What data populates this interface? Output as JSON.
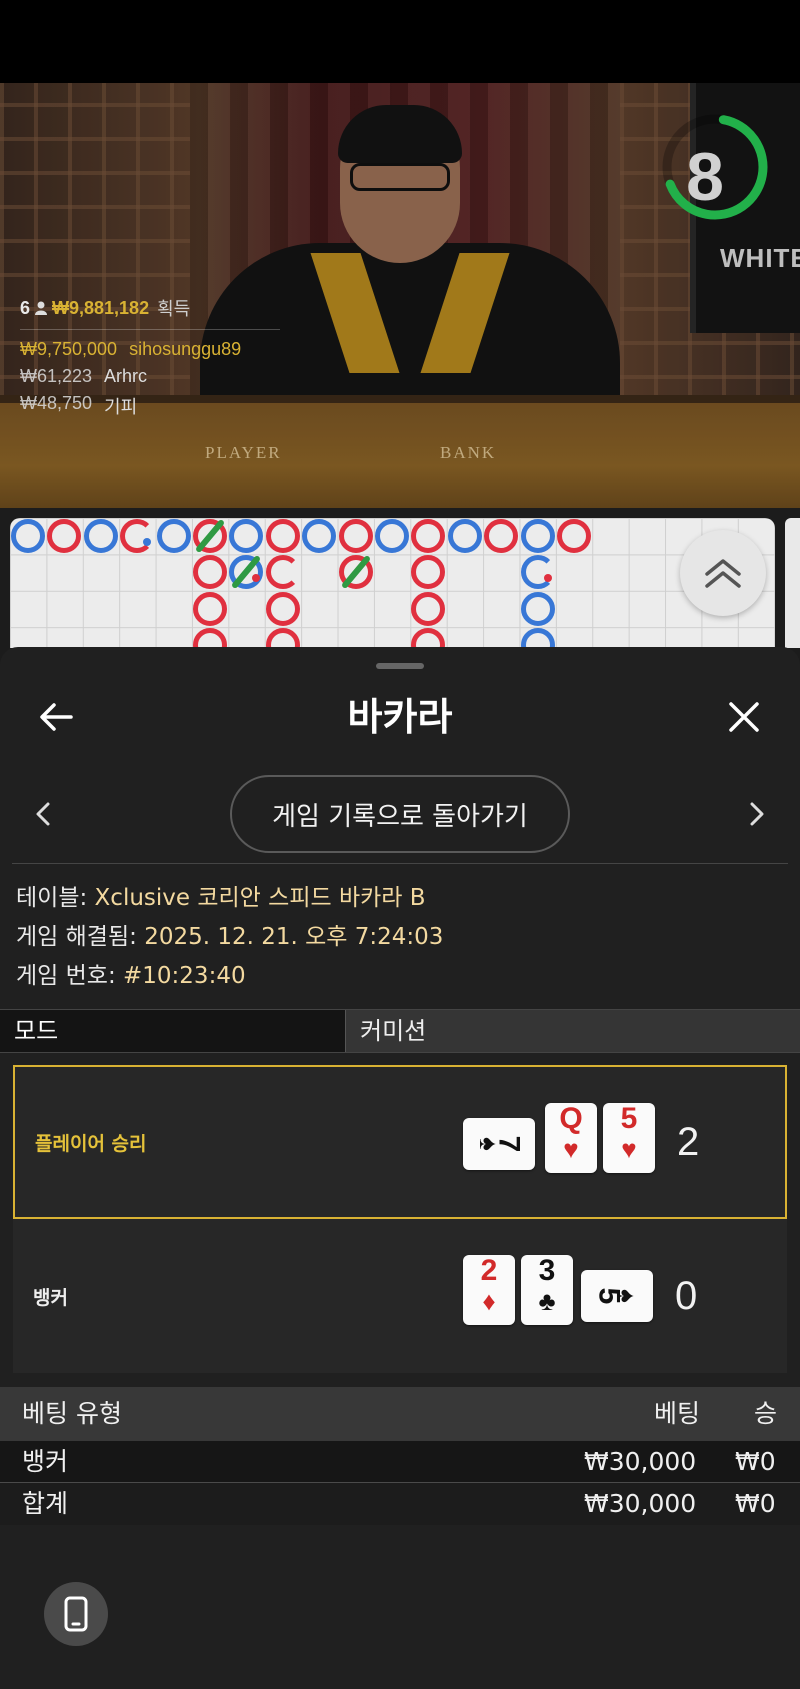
{
  "stream": {
    "timer_value": "8",
    "monitor_text": "WHITE",
    "table_labels": [
      "PLAYER",
      "BANK"
    ],
    "winners": {
      "count": "6",
      "total": "₩9,881,182",
      "label": "획득",
      "rows": [
        {
          "amount": "₩9,750,000",
          "name": "sihosunggu89"
        },
        {
          "amount": "₩61,223",
          "name": "Arhrc"
        },
        {
          "amount": "₩48,750",
          "name": "기피"
        }
      ]
    }
  },
  "sheet": {
    "title": "바카라",
    "history_button": "게임 기록으로 돌아가기",
    "info": {
      "table_key": "테이블:",
      "table_value": "Xclusive 코리안 스피드 바카라 B",
      "resolved_key": "게임 해결됨:",
      "resolved_value": "2025. 12. 21. 오후 7:24:03",
      "number_key": "게임 번호:",
      "number_value": "#10:23:40"
    },
    "tabs": {
      "mode": "모드",
      "commission": "커미션"
    },
    "results": {
      "player": {
        "label": "플레이어 승리",
        "score": "2",
        "cards": [
          {
            "rank": "7",
            "suit": "♠",
            "color": "black",
            "orientation": "side"
          },
          {
            "rank": "Q",
            "suit": "♥",
            "color": "red",
            "orientation": "up"
          },
          {
            "rank": "5",
            "suit": "♥",
            "color": "red",
            "orientation": "up"
          }
        ]
      },
      "banker": {
        "label": "뱅커",
        "score": "0",
        "cards": [
          {
            "rank": "2",
            "suit": "♦",
            "color": "red",
            "orientation": "up"
          },
          {
            "rank": "3",
            "suit": "♣",
            "color": "black",
            "orientation": "up"
          },
          {
            "rank": "5",
            "suit": "♠",
            "color": "black",
            "orientation": "side"
          }
        ]
      }
    },
    "bets": {
      "headers": {
        "type": "베팅 유형",
        "bet": "베팅",
        "win": "승"
      },
      "rows": [
        {
          "type": "뱅커",
          "bet": "₩30,000",
          "win": "₩0"
        },
        {
          "type": "합계",
          "bet": "₩30,000",
          "win": "₩0"
        }
      ]
    }
  },
  "colors": {
    "player_blue": "#3877d6",
    "banker_red": "#e0303f",
    "tie_green": "#2f9a43",
    "gold": "#d9b233",
    "timer_green": "#22b04a"
  }
}
